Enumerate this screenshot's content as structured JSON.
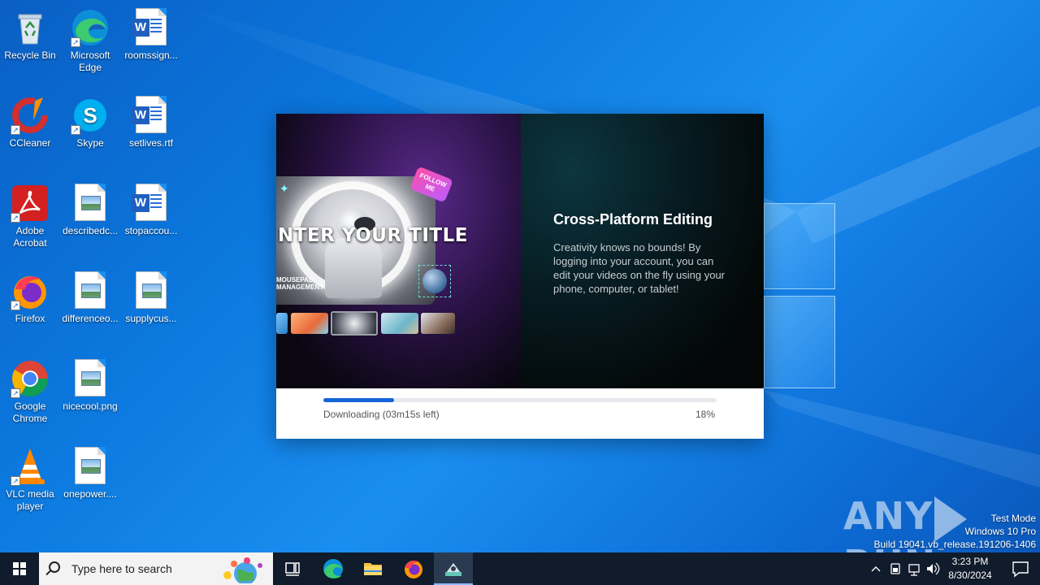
{
  "desktop": {
    "icons": [
      {
        "label": "Recycle Bin",
        "icon": "recycle-bin-icon"
      },
      {
        "label": "Microsoft Edge",
        "icon": "edge-icon"
      },
      {
        "label": "roomssign...",
        "icon": "word-document-icon"
      },
      {
        "label": "CCleaner",
        "icon": "ccleaner-icon"
      },
      {
        "label": "Skype",
        "icon": "skype-icon"
      },
      {
        "label": "setlives.rtf",
        "icon": "word-document-icon"
      },
      {
        "label": "Adobe Acrobat",
        "icon": "acrobat-icon"
      },
      {
        "label": "describedc...",
        "icon": "image-file-icon"
      },
      {
        "label": "stopaccou...",
        "icon": "word-document-icon"
      },
      {
        "label": "Firefox",
        "icon": "firefox-icon"
      },
      {
        "label": "differenceo...",
        "icon": "image-file-icon"
      },
      {
        "label": "supplycus...",
        "icon": "image-file-icon"
      },
      {
        "label": "Google Chrome",
        "icon": "chrome-icon"
      },
      {
        "label": "nicecool.png",
        "icon": "image-file-icon"
      },
      {
        "label": "VLC media player",
        "icon": "vlc-icon"
      },
      {
        "label": "onepower....",
        "icon": "image-file-icon"
      }
    ]
  },
  "installer": {
    "preview": {
      "title_overlay": "NTER YOUR TITLE",
      "subtitle_overlay": "MOUSEPAD\nMANAGEMENT",
      "badge": "FOLLOW ME"
    },
    "feature_title": "Cross-Platform Editing",
    "feature_desc": "Creativity knows no bounds! By logging into your account, you can edit your videos on the fly using your phone, computer, or tablet!",
    "status": "Downloading (03m15s left)",
    "percent_label": "18%",
    "progress": 0.18,
    "accent": "#1565d8"
  },
  "watermark": {
    "left": "ANY",
    "right": "RUN"
  },
  "os_info": {
    "line1": "Test Mode",
    "line2": "Windows 10 Pro",
    "line3": "Build 19041.vb_release.191206-1406"
  },
  "taskbar": {
    "search_placeholder": "Type here to search",
    "apps": [
      "task-view-icon",
      "edge-icon",
      "file-explorer-icon",
      "firefox-icon",
      "installer-app-icon"
    ],
    "clock_time": "3:23 PM",
    "clock_date": "8/30/2024"
  }
}
